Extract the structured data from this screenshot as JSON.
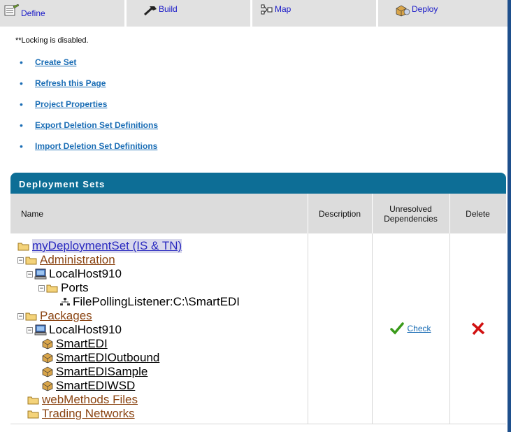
{
  "tabs": [
    {
      "label": "Define",
      "icon": "define-icon"
    },
    {
      "label": "Build",
      "icon": "build-icon"
    },
    {
      "label": "Map",
      "icon": "map-icon"
    },
    {
      "label": "Deploy",
      "icon": "deploy-icon"
    }
  ],
  "notice": "**Locking is disabled.",
  "links": [
    "Create Set",
    "Refresh this Page",
    "Project Properties",
    "Export Deletion Set Definitions",
    "Import Deletion Set Definitions"
  ],
  "panel": {
    "title": "Deployment Sets",
    "columns": {
      "name": "Name",
      "description": "Description",
      "unresolved": "Unresolved Dependencies",
      "delete": "Delete"
    }
  },
  "tree": {
    "root": "myDeploymentSet (IS & TN)",
    "administration": "Administration",
    "admin_host": "LocalHost910",
    "ports": "Ports",
    "listener": "FilePollingListener:C:\\SmartEDI",
    "packages": "Packages",
    "pkg_host": "LocalHost910",
    "package_list": [
      "SmartEDI",
      "SmartEDIOutbound",
      "SmartEDISample",
      "SmartEDIWSD"
    ],
    "webmethods_files": "webMethods Files",
    "trading_networks": "Trading Networks"
  },
  "row": {
    "description": "",
    "check_label": "Check"
  },
  "colors": {
    "panel_header": "#0d6e96",
    "link": "#1a6db5",
    "tab_bg": "#e1e1e1",
    "delete": "#d11010",
    "check": "#3a9a1a"
  }
}
